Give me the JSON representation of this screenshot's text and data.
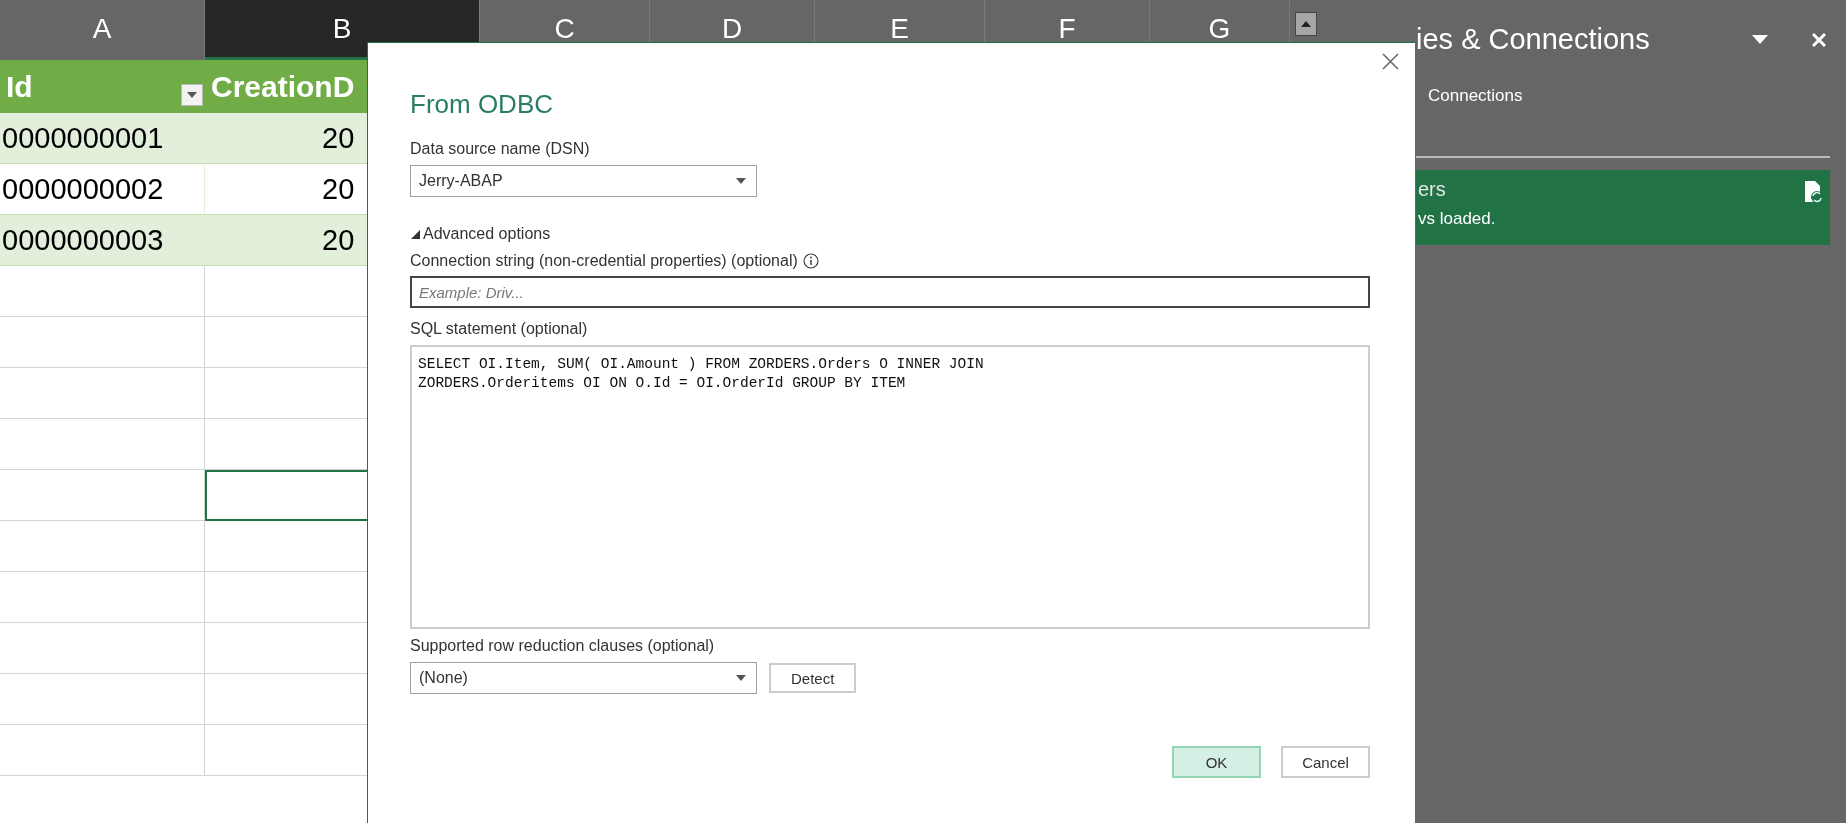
{
  "sheet": {
    "columns": [
      {
        "label": "A",
        "selected": false
      },
      {
        "label": "B",
        "selected": true
      },
      {
        "label": "C",
        "selected": false
      },
      {
        "label": "D",
        "selected": false
      },
      {
        "label": "E",
        "selected": false
      },
      {
        "label": "F",
        "selected": false
      },
      {
        "label": "G",
        "selected": false
      }
    ],
    "table": {
      "headers": [
        "Id",
        "CreationD"
      ],
      "rows": [
        [
          "0000000001",
          "20"
        ],
        [
          "0000000002",
          "20"
        ],
        [
          "0000000003",
          "20"
        ]
      ]
    },
    "blank_rows": [
      {
        "cells": [
          {
            "selected": false
          },
          {
            "selected": false
          }
        ]
      },
      {
        "cells": [
          {
            "selected": false
          },
          {
            "selected": false
          }
        ]
      },
      {
        "cells": [
          {
            "selected": false
          },
          {
            "selected": false
          }
        ]
      },
      {
        "cells": [
          {
            "selected": false
          },
          {
            "selected": false
          }
        ]
      },
      {
        "cells": [
          {
            "selected": false
          },
          {
            "selected": true
          }
        ]
      },
      {
        "cells": [
          {
            "selected": false
          },
          {
            "selected": false
          }
        ]
      },
      {
        "cells": [
          {
            "selected": false
          },
          {
            "selected": false
          }
        ]
      },
      {
        "cells": [
          {
            "selected": false
          },
          {
            "selected": false
          }
        ]
      },
      {
        "cells": [
          {
            "selected": false
          },
          {
            "selected": false
          }
        ]
      },
      {
        "cells": [
          {
            "selected": false
          },
          {
            "selected": false
          }
        ]
      }
    ]
  },
  "dialog": {
    "title": "From ODBC",
    "dsn": {
      "label": "Data source name (DSN)",
      "value": "Jerry-ABAP"
    },
    "advanced": {
      "label": "Advanced options",
      "expanded": true
    },
    "connection_string": {
      "label": "Connection string (non-credential properties) (optional)",
      "placeholder": "Example: Driv..."
    },
    "sql": {
      "label": "SQL statement (optional)",
      "lines": [
        "SELECT OI.Item, SUM( OI.Amount ) FROM ZORDERS.Orders O INNER JOIN",
        "ZORDERS.Orderitems OI ON O.Id = OI.OrderId GROUP BY ITEM"
      ]
    },
    "row_reduction": {
      "label": "Supported row reduction clauses (optional)",
      "value": "(None)",
      "button": "Detect"
    },
    "buttons": [
      {
        "label": "OK",
        "kind": "primary"
      },
      {
        "label": "Cancel",
        "kind": "secondary"
      }
    ]
  },
  "panel": {
    "title": "ies & Connections",
    "tabs": [
      {
        "label": "Connections",
        "selected": false
      }
    ],
    "query": {
      "name": "ers",
      "status": "vs loaded."
    }
  }
}
